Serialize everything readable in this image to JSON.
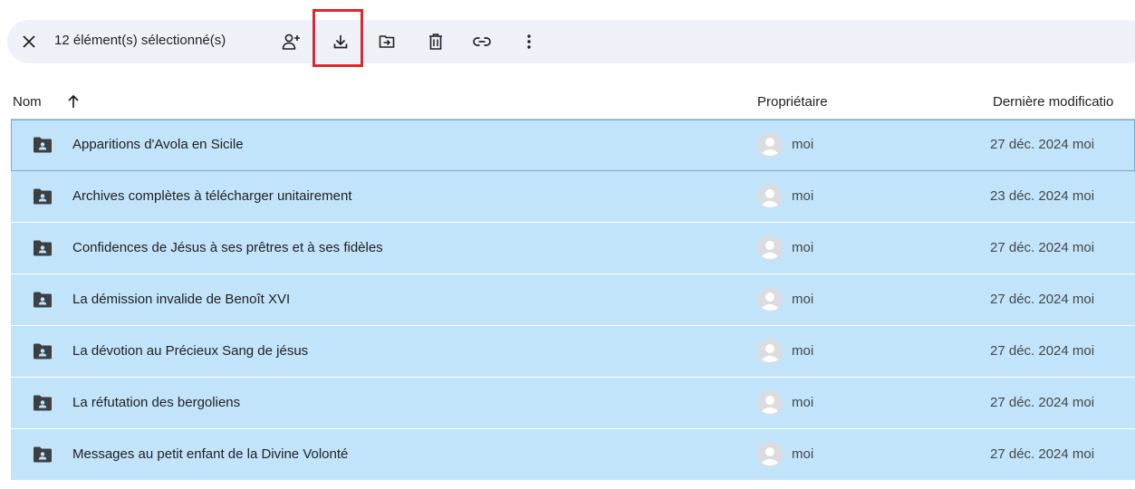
{
  "selection_toolbar": {
    "count_label": "12 élément(s) sélectionné(s)",
    "icons": [
      "close-icon",
      "share-icon",
      "download-icon",
      "move-to-folder-icon",
      "trash-icon",
      "link-icon",
      "more-vert-icon"
    ],
    "highlight_color": "#e0252b"
  },
  "table": {
    "columns": {
      "name": "Nom",
      "owner": "Propriétaire",
      "modified": "Dernière modificatio"
    },
    "sort_icon": "arrow-up-icon",
    "selected_row_color": "#c2e4fb",
    "rows": [
      {
        "name": "Apparitions d'Avola en Sicile",
        "owner": "moi",
        "modified": "27 déc. 2024 moi"
      },
      {
        "name": "Archives complètes à télécharger unitairement",
        "owner": "moi",
        "modified": "23 déc. 2024 moi"
      },
      {
        "name": "Confidences de Jésus à ses prêtres et à ses fidèles",
        "owner": "moi",
        "modified": "27 déc. 2024 moi"
      },
      {
        "name": "La démission invalide de Benoît XVI",
        "owner": "moi",
        "modified": "27 déc. 2024 moi"
      },
      {
        "name": "La dévotion au Précieux Sang de jésus",
        "owner": "moi",
        "modified": "27 déc. 2024 moi"
      },
      {
        "name": "La réfutation des bergoliens",
        "owner": "moi",
        "modified": "27 déc. 2024 moi"
      },
      {
        "name": "Messages au petit enfant de la Divine Volonté",
        "owner": "moi",
        "modified": "27 déc. 2024 moi"
      }
    ]
  }
}
